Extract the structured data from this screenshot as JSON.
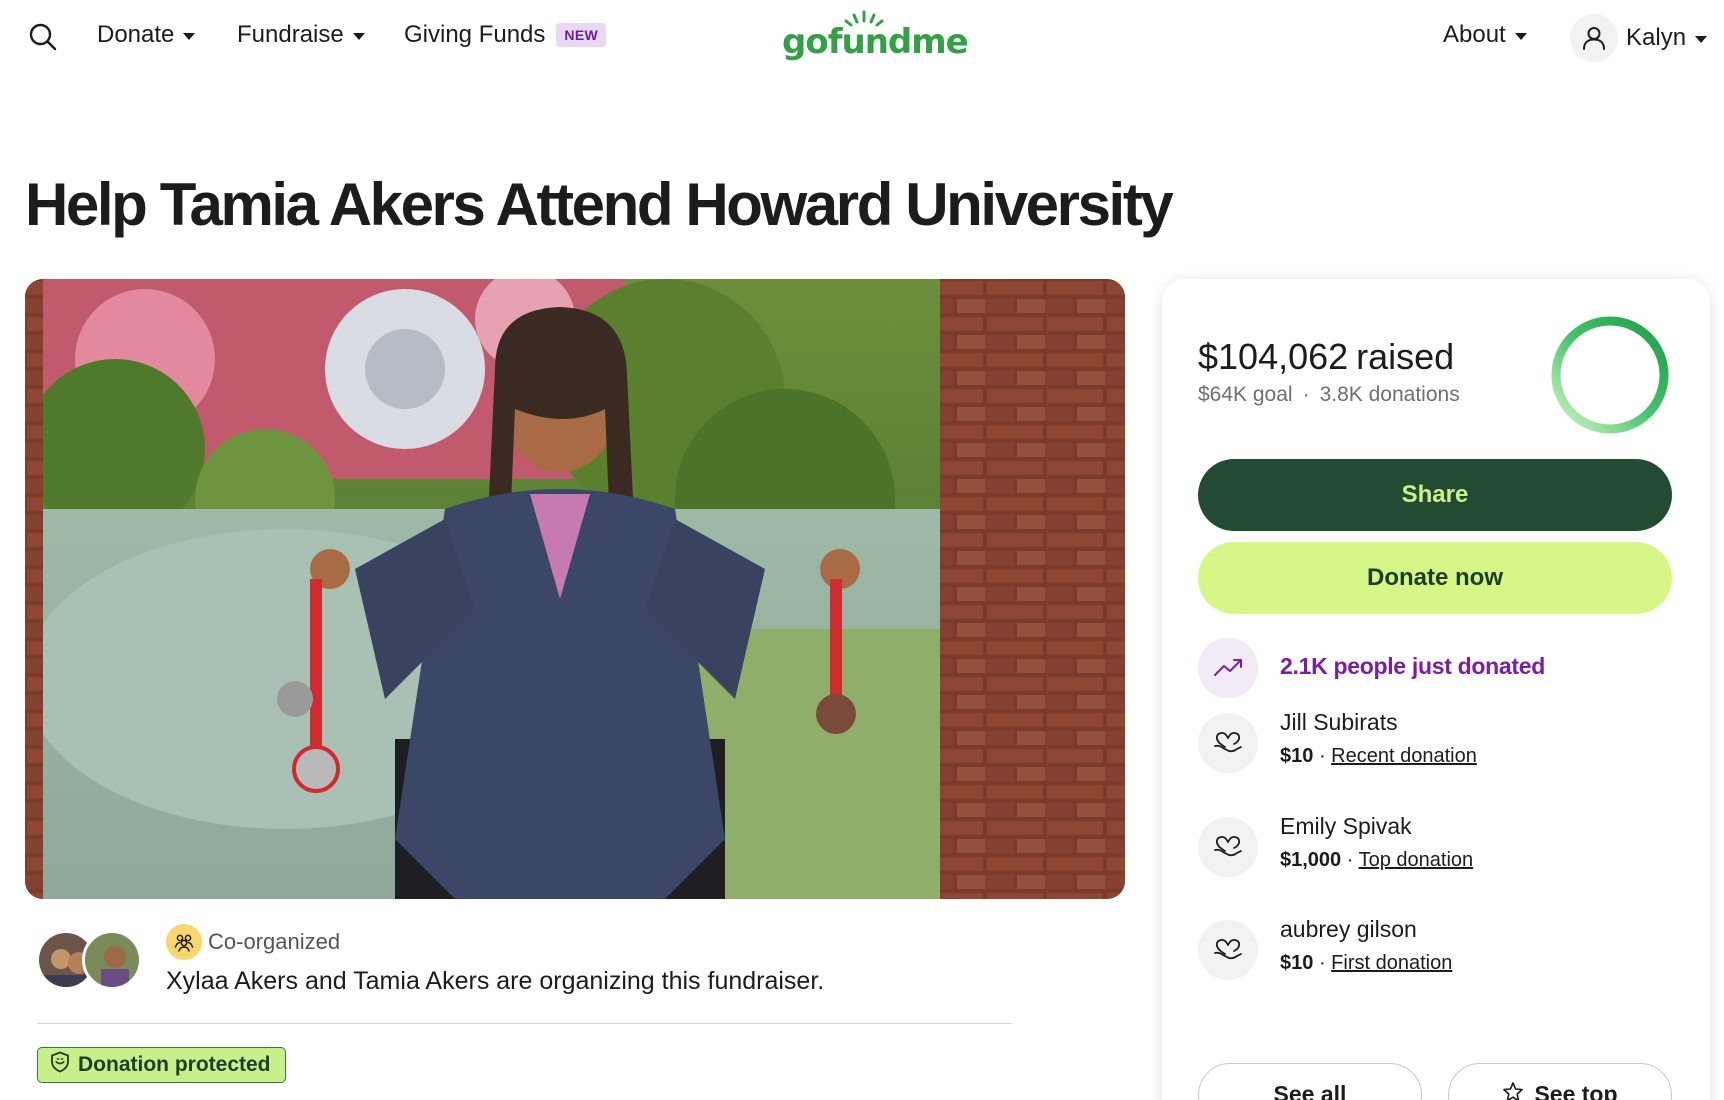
{
  "header": {
    "nav": {
      "donate_label": "Donate",
      "fundraise_label": "Fundraise",
      "giving_funds_label": "Giving Funds",
      "new_badge": "NEW",
      "about_label": "About"
    },
    "logo_text": "gofundme",
    "user_name": "Kalyn"
  },
  "campaign": {
    "title": "Help Tamia Akers Attend Howard University",
    "co_organized_label": "Co-organized",
    "organizers_text": "Xylaa Akers and Tamia Akers are organizing this fundraiser.",
    "protection_badge": "Donation protected"
  },
  "stats": {
    "raised_amount": "$104,062",
    "raised_word": "raised",
    "goal": "$64K goal",
    "separator": "·",
    "donations": "3.8K donations",
    "progress_fraction": 1.0
  },
  "actions": {
    "share_label": "Share",
    "donate_label": "Donate now"
  },
  "activity": {
    "just_donated": "2.1K people just donated"
  },
  "donors": [
    {
      "name": "Jill Subirats",
      "amount": "$10",
      "separator": "·",
      "tag": "Recent donation"
    },
    {
      "name": "Emily Spivak",
      "amount": "$1,000",
      "separator": "·",
      "tag": "Top donation"
    },
    {
      "name": "aubrey gilson",
      "amount": "$10",
      "separator": "·",
      "tag": "First donation"
    }
  ],
  "buttons": {
    "see_all": "See all",
    "see_top": "See top"
  },
  "colors": {
    "brand_green": "#33a047",
    "share_bg": "#234a32",
    "share_text": "#c9f28c",
    "donate_bg": "#d6f788",
    "accent_purple": "#7a1fa5"
  }
}
